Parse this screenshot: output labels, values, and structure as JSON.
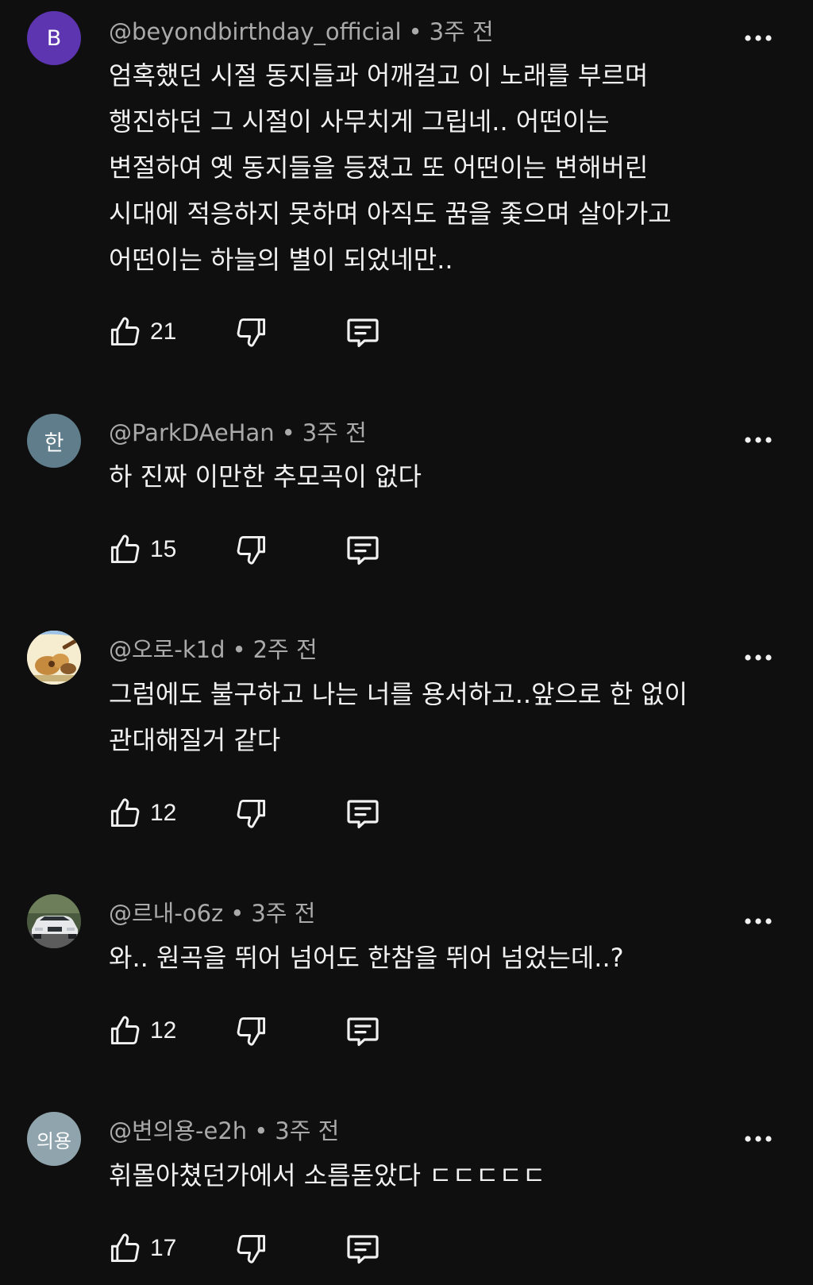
{
  "colors": {
    "background": "#0f0f0f",
    "text": "#f1f1f1",
    "meta": "#aaaaaa",
    "avatar_b": "#5e35b1",
    "avatar_letters": "#607d8b"
  },
  "icons": {
    "like": "thumbs-up-icon",
    "dislike": "thumbs-down-icon",
    "reply": "reply-comment-icon",
    "more": "more-options-icon"
  },
  "comments": [
    {
      "author": "@beyondbirthday_official",
      "time": "3주 전",
      "avatar": {
        "type": "letter",
        "text": "B"
      },
      "text": "엄혹했던 시절 동지들과 어깨걸고 이 노래를 부르며\n행진하던 그 시절이 사무치게 그립네.. 어떤이는\n변절하여 옛 동지들을 등졌고 또 어떤이는 변해버린\n시대에 적응하지 못하며 아직도 꿈을 좇으며 살아가고\n어떤이는 하늘의 별이 되었네만..",
      "likes": "21"
    },
    {
      "author": "@ParkDAeHan",
      "time": "3주 전",
      "avatar": {
        "type": "letter",
        "text": "한"
      },
      "text": "하 진짜 이만한 추모곡이 없다",
      "likes": "15"
    },
    {
      "author": "@오로-k1d",
      "time": "2주 전",
      "avatar": {
        "type": "image",
        "text": ""
      },
      "text": "그럼에도 불구하고 나는 너를 용서하고..앞으로 한 없이\n관대해질거 같다",
      "likes": "12"
    },
    {
      "author": "@르내-o6z",
      "time": "3주 전",
      "avatar": {
        "type": "image",
        "text": ""
      },
      "text": "와.. 원곡을 뛰어 넘어도 한참을 뛰어 넘었는데..?",
      "likes": "12"
    },
    {
      "author": "@변의용-e2h",
      "time": "3주 전",
      "avatar": {
        "type": "letter",
        "text": "의용"
      },
      "text": "휘몰아쳤던가에서 소름돋았다 ㄷㄷㄷㄷㄷ",
      "likes": "17"
    }
  ]
}
